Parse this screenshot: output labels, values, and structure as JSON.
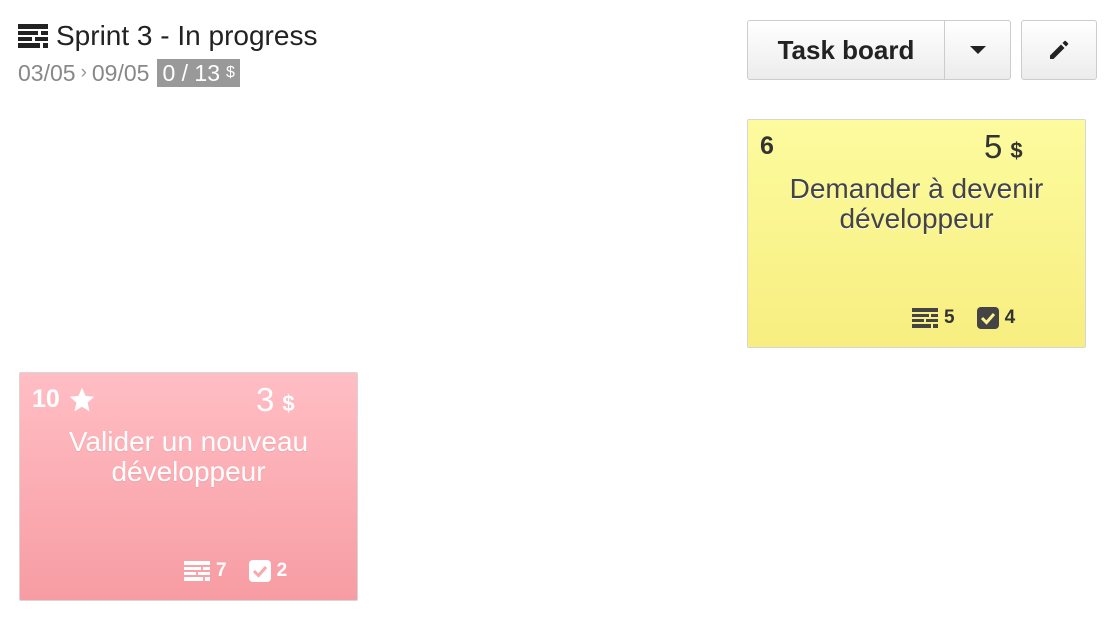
{
  "sprint": {
    "title": "Sprint 3 - In progress",
    "date_start": "03/05",
    "date_end": "09/05",
    "points_badge": "0 / 13",
    "currency": "$",
    "separator": "›"
  },
  "toolbar": {
    "view_label": "Task board",
    "dropdown_icon": "caret-down-icon",
    "edit_icon": "pencil-icon"
  },
  "cards": [
    {
      "id": "6",
      "points": "5",
      "currency": "$",
      "title": "Demander à devenir développeur",
      "story_count": "5",
      "task_count": "4",
      "color": "#fbf38f",
      "starred": false
    },
    {
      "id": "10",
      "points": "3",
      "currency": "$",
      "title": "Valider un nouveau développeur",
      "story_count": "7",
      "task_count": "2",
      "color": "#fbaab0",
      "starred": true
    }
  ],
  "colors": {
    "badge": "#999999",
    "yellow_card": "#fbf38f",
    "red_card": "#fbaab0"
  }
}
